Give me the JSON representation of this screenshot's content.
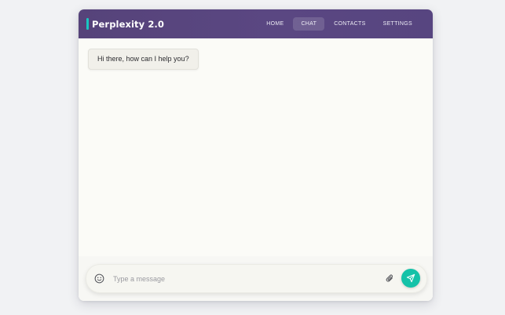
{
  "header": {
    "title": "Perplexity 2.0",
    "accent_color": "#19c8c1",
    "nav": [
      {
        "label": "HOME",
        "active": false
      },
      {
        "label": "CHAT",
        "active": true
      },
      {
        "label": "CONTACTS",
        "active": false
      },
      {
        "label": "SETTINGS",
        "active": false
      }
    ]
  },
  "messages": [
    {
      "sender": "bot",
      "text": "Hi there, how can I help you?"
    }
  ],
  "composer": {
    "placeholder": "Type a message",
    "value": "",
    "emoji_icon": "smiley-face-icon",
    "attach_icon": "paperclip-icon",
    "send_icon": "paper-plane-icon",
    "send_color": "#14c2a8"
  }
}
